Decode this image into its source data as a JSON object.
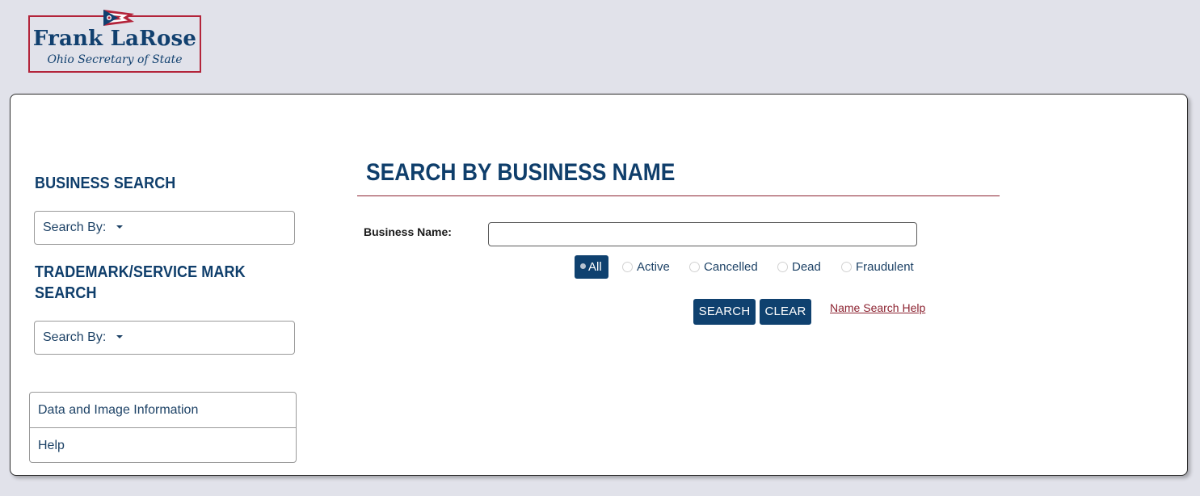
{
  "logo": {
    "name": "Frank LaRose",
    "subtitle": "Ohio Secretary of State"
  },
  "sidebar": {
    "business_heading": "BUSINESS SEARCH",
    "business_searchby": "Search By:",
    "trademark_heading": "TRADEMARK/SERVICE MARK SEARCH",
    "trademark_searchby": "Search By:",
    "links": [
      {
        "label": "Data and Image Information"
      },
      {
        "label": "Help"
      }
    ]
  },
  "main": {
    "title": "SEARCH BY BUSINESS NAME",
    "business_name_label": "Business Name:",
    "business_name_value": "",
    "status_options": {
      "all": "All",
      "active": "Active",
      "cancelled": "Cancelled",
      "dead": "Dead",
      "fraudulent": "Fraudulent",
      "selected": "All"
    },
    "search_button": "SEARCH",
    "clear_button": "CLEAR",
    "help_link": "Name Search Help"
  },
  "colors": {
    "navy": "#0f416f",
    "accent_red": "#8c2230",
    "page_background": "#e1e2ea"
  },
  "icons": {
    "logo_flag": "ohio-flag-icon",
    "dropdown": "caret-down-icon"
  }
}
